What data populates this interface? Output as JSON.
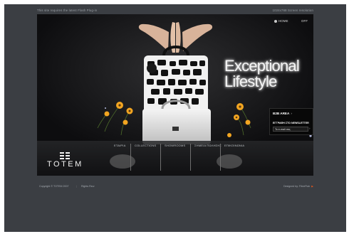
{
  "topbar": {
    "flash_notice": "This site requires the latest Flash Plug-in",
    "resolution_notice": "1024x768 Screen resolution"
  },
  "utility": {
    "home_label": "HOME",
    "sound_label": "OFF"
  },
  "hero": {
    "headline_line1": "Exceptional",
    "headline_line2": "Lifestyle"
  },
  "panel": {
    "b2b_label": "B2B AREA",
    "b2b_arrow": "›",
    "newsletter_label": "ΕΓΓΡΑΦΗ ΣΤΟ NEWSLETTER",
    "email_value": "Το e-mail σας",
    "go_arrow": "›"
  },
  "nav": {
    "items": [
      {
        "label": "ETAIPIA"
      },
      {
        "label": "COLLECTIONS"
      },
      {
        "label": "SHOWROOMS"
      },
      {
        "label": "ΣΗΜΕΙΑ ΠΩΛΗΣΗΣ"
      },
      {
        "label": "ΕΠΙΚΟΙΝΩΝΙΑ"
      }
    ]
  },
  "brand": {
    "wordmark": "TOTEM"
  },
  "footer": {
    "copyright": "Copyright © TOTEM 2007",
    "separator": "|",
    "rights": "Rights Rsrv",
    "credit": "Designed by: FibreFlair"
  },
  "colors": {
    "page_bg": "#3b3e43",
    "stage_bg": "#101012",
    "flower": "#f2a521",
    "footer_accent": "#e0571d"
  }
}
